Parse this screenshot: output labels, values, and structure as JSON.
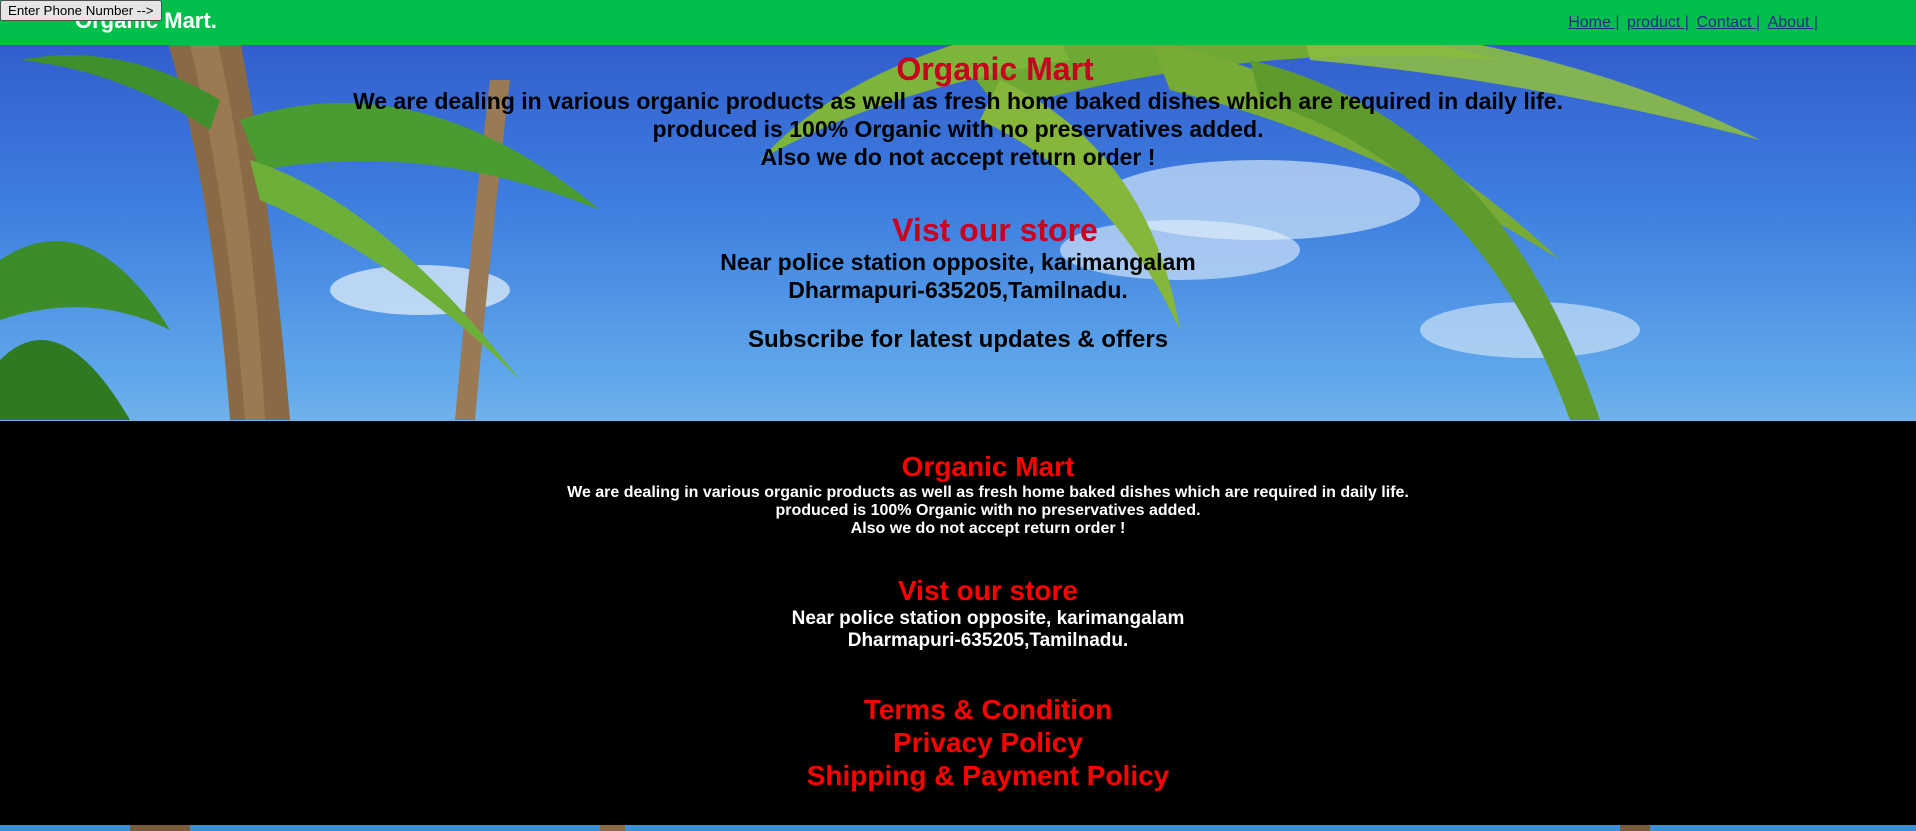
{
  "header": {
    "brand": "Organic Mart.",
    "nav": [
      "Home |",
      "product |",
      "Contact |",
      "About |"
    ]
  },
  "hero": {
    "title": "Organic Mart",
    "description_lines": [
      "We are dealing in various organic products as well as fresh home baked dishes which are required in daily life.",
      "produced is 100% Organic with no preservatives added.",
      "Also we do not accept return order !"
    ],
    "store_title": "Vist our store",
    "store_address_lines": [
      "Near police station opposite, karimangalam",
      "Dharmapuri-635205,Tamilnadu."
    ],
    "subscribe_text": "Subscribe for latest updates & offers",
    "phone_button": "Enter Phone Number -->"
  },
  "footer": {
    "title": "Organic Mart",
    "description_lines": [
      "We are dealing in various organic products as well as fresh home baked dishes which are required in daily life.",
      "produced is 100% Organic with no preservatives added.",
      "Also we do not accept return order !"
    ],
    "store_title": "Vist our store",
    "store_address_lines": [
      "Near police station opposite, karimangalam",
      "Dharmapuri-635205,Tamilnadu."
    ],
    "links": [
      "Terms & Condition",
      "Privacy Policy",
      "Shipping & Payment Policy"
    ]
  },
  "colors": {
    "header_bg": "#00c04b",
    "accent_red": "#c8001e",
    "footer_red": "#ff0000",
    "footer_bg": "#000000"
  }
}
